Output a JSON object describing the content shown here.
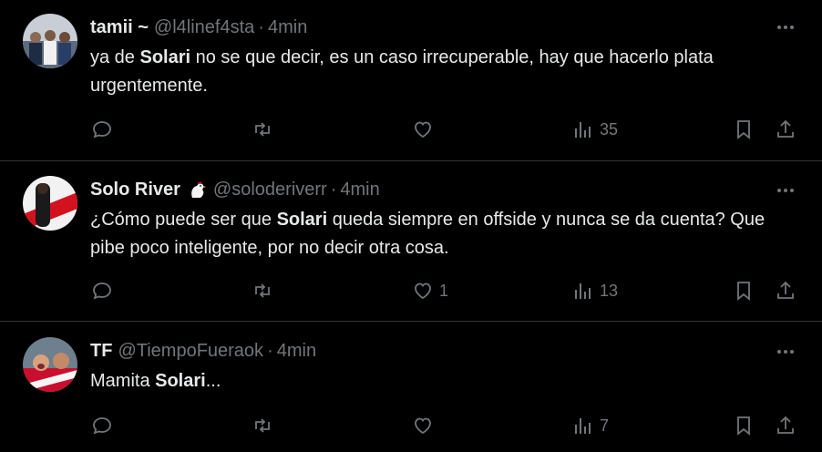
{
  "tweets": [
    {
      "name": "tamii ~",
      "handle": "@l4linef4sta",
      "separator": "·",
      "time": "4min",
      "text_parts": [
        "ya de ",
        "Solari",
        " no se que decir, es un caso irrecuperable, hay que hacerlo plata urgentemente."
      ],
      "replies": "",
      "retweets": "",
      "likes": "",
      "views": "35"
    },
    {
      "name": "Solo River",
      "handle": "@soloderiverr",
      "separator": "·",
      "time": "4min",
      "text_parts": [
        "¿Cómo puede ser que ",
        "Solari",
        " queda siempre en offside y nunca se da cuenta? Que pibe poco inteligente, por no decir otra cosa."
      ],
      "replies": "",
      "retweets": "",
      "likes": "1",
      "views": "13"
    },
    {
      "name": "TF",
      "handle": "@TiempoFueraok",
      "separator": "·",
      "time": "4min",
      "text_parts": [
        "Mamita ",
        "Solari",
        "..."
      ],
      "replies": "",
      "retweets": "",
      "likes": "",
      "views": "7"
    }
  ],
  "colors": {
    "background": "#000000",
    "text": "#e7e9ea",
    "muted": "#71767b",
    "divider": "#2f3336"
  },
  "icons": [
    "more-icon",
    "reply-icon",
    "retweet-icon",
    "like-icon",
    "views-icon",
    "bookmark-icon",
    "share-icon",
    "rooster-emoji-icon"
  ]
}
